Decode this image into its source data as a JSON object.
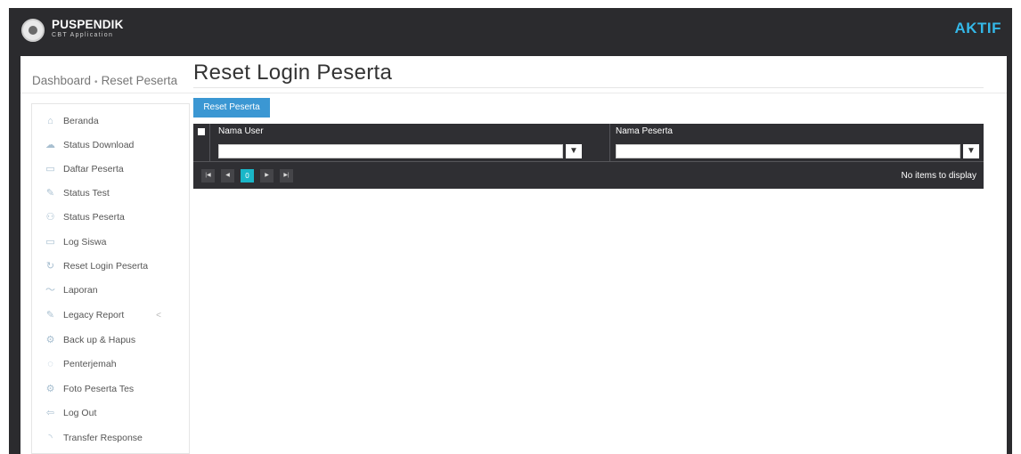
{
  "header": {
    "brand": "PUSPENDIK",
    "brand_sub": "CBT Application",
    "status": "AKTIF"
  },
  "breadcrumb": {
    "root": "Dashboard",
    "separator": "•",
    "current": "Reset Peserta"
  },
  "sidebar": {
    "items": [
      {
        "label": "Beranda",
        "icon": "home-icon"
      },
      {
        "label": "Status Download",
        "icon": "cloud-download-icon"
      },
      {
        "label": "Daftar Peserta",
        "icon": "folder-icon"
      },
      {
        "label": "Status Test",
        "icon": "edit-icon"
      },
      {
        "label": "Status Peserta",
        "icon": "user-icon"
      },
      {
        "label": "Log Siswa",
        "icon": "folder-icon"
      },
      {
        "label": "Reset Login Peserta",
        "icon": "refresh-icon"
      },
      {
        "label": "Laporan",
        "icon": "line-chart-icon"
      },
      {
        "label": "Legacy Report",
        "icon": "edit-icon"
      },
      {
        "label": "Back up & Hapus",
        "icon": "gear-icon"
      },
      {
        "label": "Penterjemah",
        "icon": "chat-icon"
      },
      {
        "label": "Foto Peserta Tes",
        "icon": "gear-icon"
      },
      {
        "label": "Log Out",
        "icon": "logout-icon"
      },
      {
        "label": "Transfer Response",
        "icon": "rss-icon"
      }
    ],
    "legacy_chevron": "<"
  },
  "main": {
    "title": "Reset Login Peserta",
    "reset_button": "Reset Peserta",
    "grid": {
      "columns": [
        "Nama User",
        "Nama Peserta"
      ],
      "filter_values": [
        "",
        ""
      ],
      "current_page": "0",
      "empty_text": "No items to display"
    }
  },
  "colors": {
    "accent": "#34b8e8",
    "button": "#3b97d3",
    "pager_active": "#1ab6c8",
    "dark": "#2b2b2e"
  }
}
